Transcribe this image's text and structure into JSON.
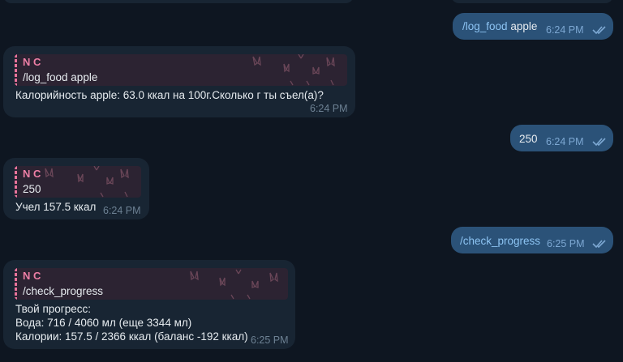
{
  "messages": {
    "m1": {
      "cmd": "/log_food",
      "rest": " apple",
      "time": "6:24 PM"
    },
    "m2": {
      "reply_name": "N C",
      "reply_text": "/log_food apple",
      "text": "Калорийность apple: 63.0 ккал на 100г.Сколько г ты съел(а)?",
      "time": "6:24 PM"
    },
    "m3": {
      "text": "250",
      "time": "6:24 PM"
    },
    "m4": {
      "reply_name": "N C",
      "reply_text": "250",
      "text": "Учел 157.5 ккал",
      "time": "6:24 PM"
    },
    "m5": {
      "text": "/check_progress",
      "time": "6:25 PM"
    },
    "m6": {
      "reply_name": "N C",
      "reply_text": "/check_progress",
      "lines": [
        "Твой прогресс:",
        "Вода: 716 / 4060 мл (еще 3344 мл)",
        "Калории: 157.5 / 2366 ккал (баланс -192 ккал)"
      ],
      "time": "6:25 PM"
    }
  },
  "icons": {
    "read_status": "double-check-icon",
    "reply_pattern": "cheers-glasses-icon"
  },
  "colors": {
    "background": "#0e1621",
    "incoming": "#182533",
    "outgoing": "#2b5278",
    "reply_accent": "#ee7fa6",
    "command": "#8cc3f2"
  }
}
